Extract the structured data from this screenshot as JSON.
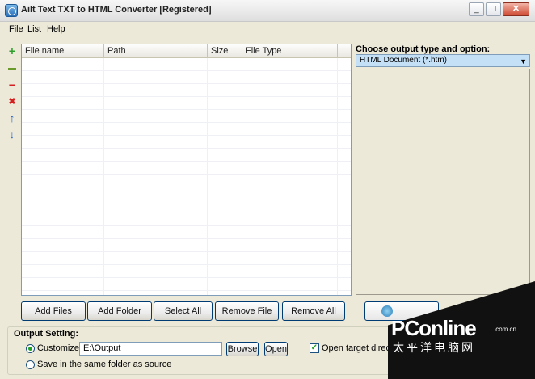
{
  "window": {
    "title": "Ailt Text TXT to HTML Converter [Registered]",
    "minimize": "_",
    "maximize": "□",
    "close": "✕"
  },
  "menu": {
    "file": "File",
    "list": "List",
    "help": "Help"
  },
  "toolbar": {
    "add_icon": "+",
    "folder_icon": "▬",
    "remove_icon": "−",
    "clear_icon": "✖",
    "up_icon": "↑",
    "down_icon": "↓"
  },
  "filelist": {
    "columns": [
      "File name",
      "Path",
      "Size",
      "File Type"
    ]
  },
  "buttons": {
    "add_files": "Add Files",
    "add_folder": "Add Folder",
    "select_all": "Select All",
    "remove_file": "Remove File",
    "remove_all": "Remove All",
    "browse": "Browse",
    "open": "Open"
  },
  "output": {
    "title": "Choose output type and option:",
    "selected": "HTML Document (*.htm)"
  },
  "settings": {
    "title": "Output Setting:",
    "customize": "Customize",
    "path": "E:\\Output",
    "same_folder": "Save in the same folder as source",
    "open_target": "Open target director"
  },
  "watermark": {
    "logo": "PConline",
    "domain": ".com.cn",
    "chinese": "太平洋电脑网"
  },
  "colors": {
    "accent": "#21a121",
    "selection": "#c4e0f6",
    "border": "#003c74"
  }
}
